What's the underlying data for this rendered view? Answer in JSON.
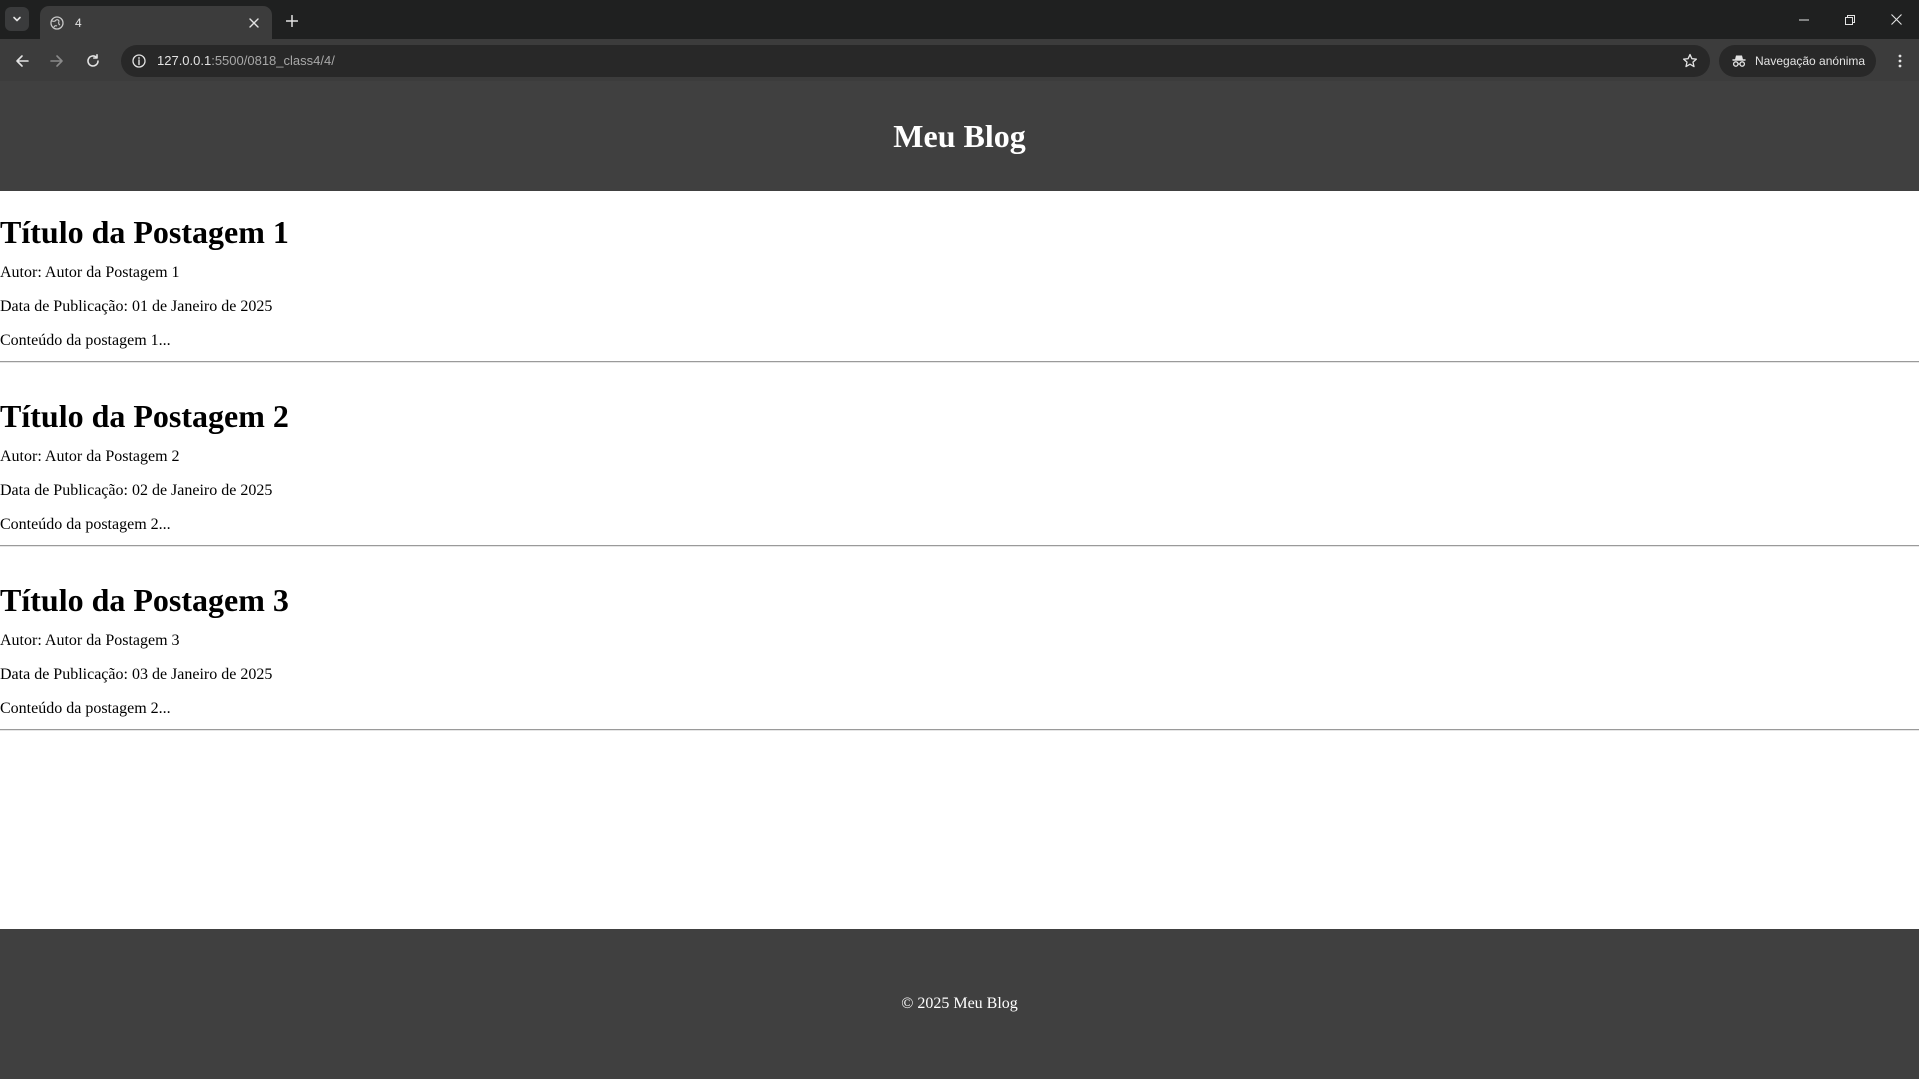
{
  "browser": {
    "tab": {
      "title": "4",
      "icon": "globe-icon"
    },
    "url_host": "127.0.0.1",
    "url_path": ":5500/0818_class4/4/",
    "incognito_label": "Navegação anónima"
  },
  "page": {
    "header_title": "Meu Blog",
    "posts": [
      {
        "title": "Título da Postagem 1",
        "author": "Autor: Autor da Postagem 1",
        "date": "Data de Publicação: 01 de Janeiro de 2025",
        "content": "Conteúdo da postagem 1..."
      },
      {
        "title": "Título da Postagem 2",
        "author": "Autor: Autor da Postagem 2",
        "date": "Data de Publicação: 02 de Janeiro de 2025",
        "content": "Conteúdo da postagem 2..."
      },
      {
        "title": "Título da Postagem 3",
        "author": "Autor: Autor da Postagem 3",
        "date": "Data de Publicação: 03 de Janeiro de 2025",
        "content": "Conteúdo da postagem 2..."
      }
    ],
    "footer_text": "© 2025 Meu Blog"
  },
  "colors": {
    "header_bg": "#404040",
    "footer_bg": "#404040",
    "chrome_bg": "#1f2020",
    "toolbar_bg": "#3c3c3c"
  }
}
